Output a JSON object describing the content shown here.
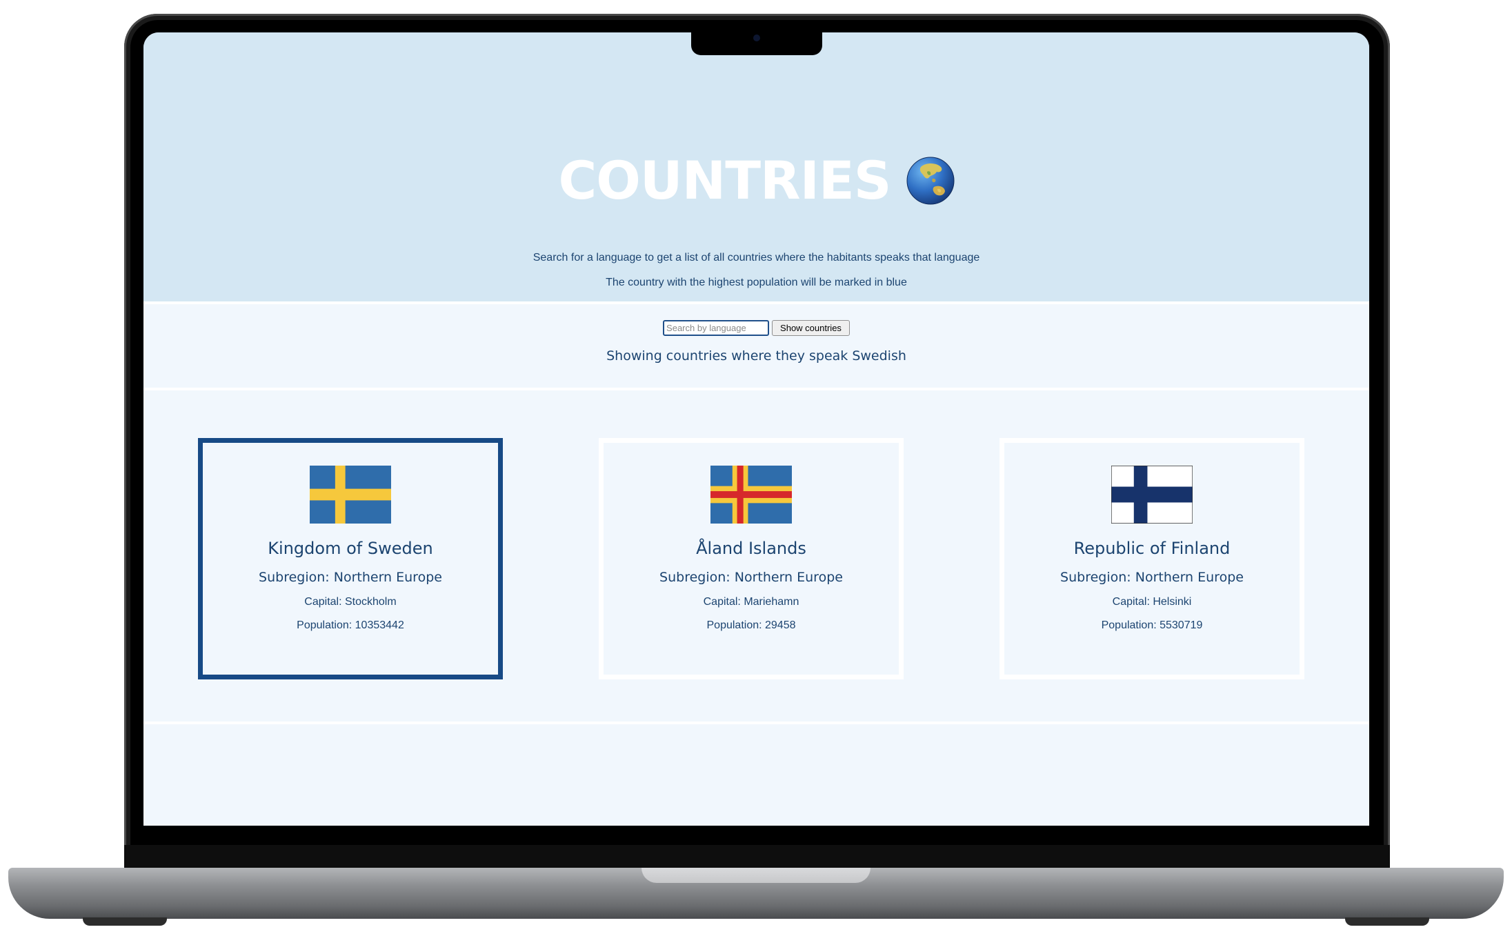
{
  "header": {
    "title": "COUNTRIES",
    "icon": "globe-asia-australia-icon",
    "description_line1": "Search for a language to get a list of all countries where the habitants speaks that language",
    "description_line2": "The country with the highest population will be marked in blue"
  },
  "search": {
    "placeholder": "Search by language",
    "value": "",
    "button_label": "Show countries"
  },
  "result_message": "Showing countries where they speak Swedish",
  "colors": {
    "highlight_border": "#174a86",
    "header_bg": "#d4e7f3",
    "page_bg": "#f1f7fd",
    "text": "#1c4470"
  },
  "countries": [
    {
      "name": "Kingdom of Sweden",
      "subregion": "Subregion: Northern Europe",
      "capital": "Capital: Stockholm",
      "population": "Population: 10353442",
      "flag": "sweden-flag-icon",
      "highlighted": true
    },
    {
      "name": "Åland Islands",
      "subregion": "Subregion: Northern Europe",
      "capital": "Capital: Mariehamn",
      "population": "Population: 29458",
      "flag": "aland-flag-icon",
      "highlighted": false
    },
    {
      "name": "Republic of Finland",
      "subregion": "Subregion: Northern Europe",
      "capital": "Capital: Helsinki",
      "population": "Population: 5530719",
      "flag": "finland-flag-icon",
      "highlighted": false
    }
  ]
}
